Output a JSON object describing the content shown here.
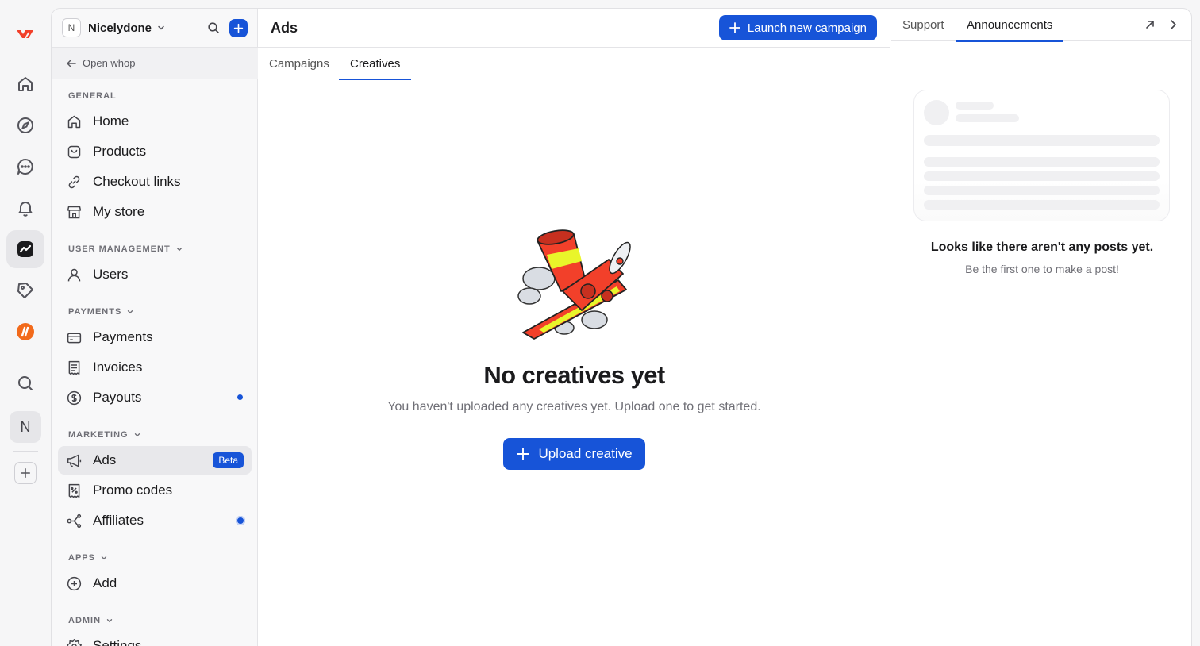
{
  "rail": {
    "items": [
      "logo-icon",
      "home-icon",
      "compass-icon",
      "chat-icon",
      "bell-icon",
      "dashboard-icon",
      "tag-icon",
      "whop-app-icon",
      "search-icon",
      "avatar",
      "add-icon"
    ],
    "avatar_letter": "N"
  },
  "workspace": {
    "avatar_letter": "N",
    "name": "Nicelydone",
    "open_whop": "Open whop"
  },
  "sidebar": {
    "general": {
      "label": "GENERAL",
      "items": [
        {
          "label": "Home",
          "icon": "home-icon"
        },
        {
          "label": "Products",
          "icon": "bag-icon"
        },
        {
          "label": "Checkout links",
          "icon": "link-icon"
        },
        {
          "label": "My store",
          "icon": "store-icon"
        }
      ]
    },
    "user_management": {
      "label": "USER MANAGEMENT",
      "items": [
        {
          "label": "Users",
          "icon": "user-icon"
        }
      ]
    },
    "payments": {
      "label": "PAYMENTS",
      "items": [
        {
          "label": "Payments",
          "icon": "card-icon"
        },
        {
          "label": "Invoices",
          "icon": "receipt-icon"
        },
        {
          "label": "Payouts",
          "icon": "dollar-icon"
        }
      ]
    },
    "marketing": {
      "label": "MARKETING",
      "items": [
        {
          "label": "Ads",
          "icon": "megaphone-icon",
          "badge": "Beta"
        },
        {
          "label": "Promo codes",
          "icon": "promo-icon"
        },
        {
          "label": "Affiliates",
          "icon": "affiliates-icon"
        }
      ]
    },
    "apps": {
      "label": "APPS",
      "items": [
        {
          "label": "Add",
          "icon": "plus-circle-icon"
        }
      ]
    },
    "admin": {
      "label": "ADMIN",
      "items": [
        {
          "label": "Settings",
          "icon": "gear-icon"
        }
      ]
    }
  },
  "main": {
    "title": "Ads",
    "launch_label": "Launch new campaign",
    "tabs": [
      "Campaigns",
      "Creatives"
    ],
    "active_tab": "Creatives",
    "empty": {
      "title": "No creatives yet",
      "subtitle": "You haven't uploaded any creatives yet. Upload one to get started.",
      "button": "Upload creative"
    }
  },
  "panel": {
    "tabs": [
      "Support",
      "Announcements"
    ],
    "active_tab": "Announcements",
    "empty_title": "Looks like there aren't any posts yet.",
    "empty_subtitle": "Be the first one to make a post!"
  },
  "colors": {
    "accent": "#1754d8",
    "brand_red": "#f2402a",
    "brand_orange": "#f26a1b"
  }
}
